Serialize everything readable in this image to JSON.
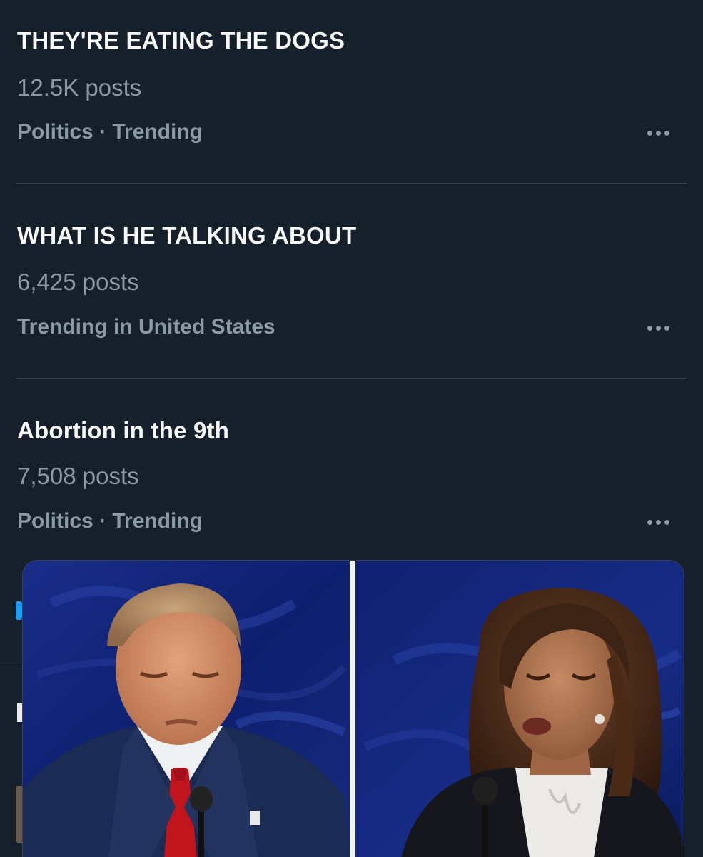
{
  "trends": [
    {
      "title": "THEY'RE EATING THE DOGS",
      "count": "12.5K posts",
      "meta": "Politics · Trending"
    },
    {
      "title": "WHAT IS HE TALKING ABOUT",
      "count": "6,425 posts",
      "meta": "Trending in United States"
    },
    {
      "title": "Abortion in the 9th",
      "count": "7,508 posts",
      "meta": "Politics · Trending"
    }
  ],
  "media_popup": {
    "left_panel": "man-at-podium-photo",
    "right_panel": "woman-at-podium-photo",
    "background_color": "#0c1c5c"
  },
  "colors": {
    "background": "#15202b",
    "primary_text": "#f7f9f9",
    "secondary_text": "#8b98a5",
    "divider": "#38444d",
    "accent": "#1d9bf0"
  }
}
